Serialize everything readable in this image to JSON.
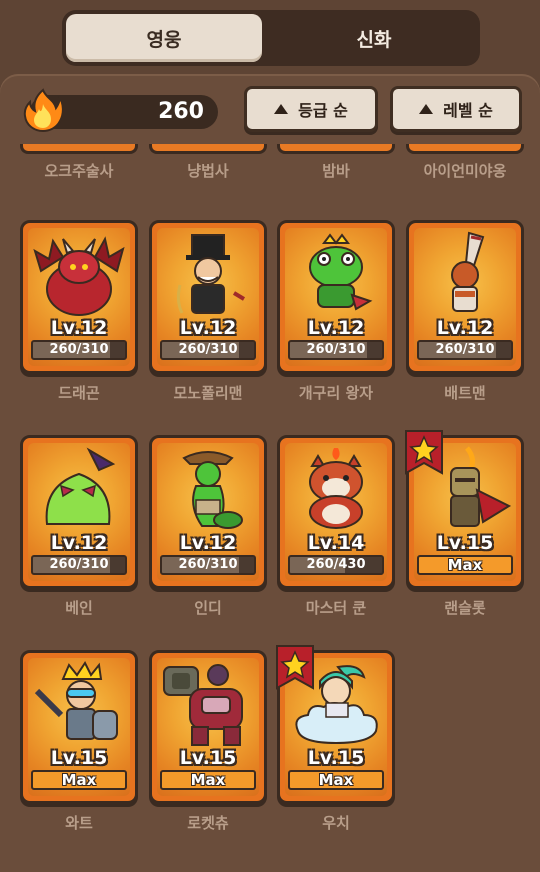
{
  "tabs": [
    {
      "label": "영웅",
      "active": true
    },
    {
      "label": "신화",
      "active": false
    }
  ],
  "currency": {
    "value": "260",
    "icon": "flame-icon"
  },
  "sort": {
    "grade_label": "등급 순",
    "level_label": "레벨 순"
  },
  "previous_row": [
    "오크주술사",
    "냥법사",
    "밤바",
    "아이언미야옹"
  ],
  "heroes": [
    {
      "name": "드래곤",
      "level": "Lv.12",
      "progress": "260/310",
      "fraction": 0.84,
      "max": false,
      "icon": "dragon-icon"
    },
    {
      "name": "모노폴리맨",
      "level": "Lv.12",
      "progress": "260/310",
      "fraction": 0.84,
      "max": false,
      "icon": "tophat-man-icon"
    },
    {
      "name": "개구리 왕자",
      "level": "Lv.12",
      "progress": "260/310",
      "fraction": 0.84,
      "max": false,
      "icon": "frog-prince-icon"
    },
    {
      "name": "배트맨",
      "level": "Lv.12",
      "progress": "260/310",
      "fraction": 0.84,
      "max": false,
      "icon": "batter-icon"
    },
    {
      "name": "베인",
      "level": "Lv.12",
      "progress": "260/310",
      "fraction": 0.84,
      "max": false,
      "icon": "slime-icon"
    },
    {
      "name": "인디",
      "level": "Lv.12",
      "progress": "260/310",
      "fraction": 0.84,
      "max": false,
      "icon": "snake-explorer-icon"
    },
    {
      "name": "마스터 쿤",
      "level": "Lv.14",
      "progress": "260/430",
      "fraction": 0.6,
      "max": false,
      "icon": "red-panda-icon"
    },
    {
      "name": "랜슬롯",
      "level": "Lv.15",
      "progress": "Max",
      "fraction": 1,
      "max": true,
      "icon": "knight-icon",
      "starred": true
    },
    {
      "name": "와트",
      "level": "Lv.15",
      "progress": "Max",
      "fraction": 1,
      "max": true,
      "icon": "vacuum-king-icon"
    },
    {
      "name": "로켓츄",
      "level": "Lv.15",
      "progress": "Max",
      "fraction": 1,
      "max": true,
      "icon": "rocket-robot-icon"
    },
    {
      "name": "우치",
      "level": "Lv.15",
      "progress": "Max",
      "fraction": 1,
      "max": true,
      "icon": "cloud-sage-icon",
      "starred": true
    }
  ],
  "colors": {
    "background": "#5e4434",
    "card_orange": "#e7731f",
    "name_text": "#b89e8a",
    "flag_red": "#b8202a",
    "star_yellow": "#ffd21f"
  }
}
